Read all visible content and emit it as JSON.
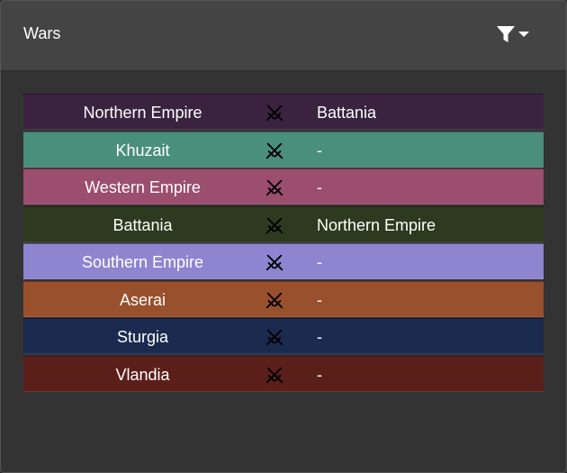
{
  "header": {
    "title": "Wars",
    "filter_icon": "filter-icon",
    "dropdown_icon": "caret-down-icon"
  },
  "rows_icon": "crossed-swords-icon",
  "rows": [
    {
      "faction": "Northern Empire",
      "enemy": "Battania",
      "color": "#3a233f"
    },
    {
      "faction": "Khuzait",
      "enemy": "-",
      "color": "#4a8e7c"
    },
    {
      "faction": "Western Empire",
      "enemy": "-",
      "color": "#9b4e6d"
    },
    {
      "faction": "Battania",
      "enemy": "Northern Empire",
      "color": "#2d3a1f"
    },
    {
      "faction": "Southern Empire",
      "enemy": "-",
      "color": "#8e84d0"
    },
    {
      "faction": "Aserai",
      "enemy": "-",
      "color": "#99502c"
    },
    {
      "faction": "Sturgia",
      "enemy": "-",
      "color": "#1b2a4f"
    },
    {
      "faction": "Vlandia",
      "enemy": "-",
      "color": "#5b1f1a"
    }
  ]
}
